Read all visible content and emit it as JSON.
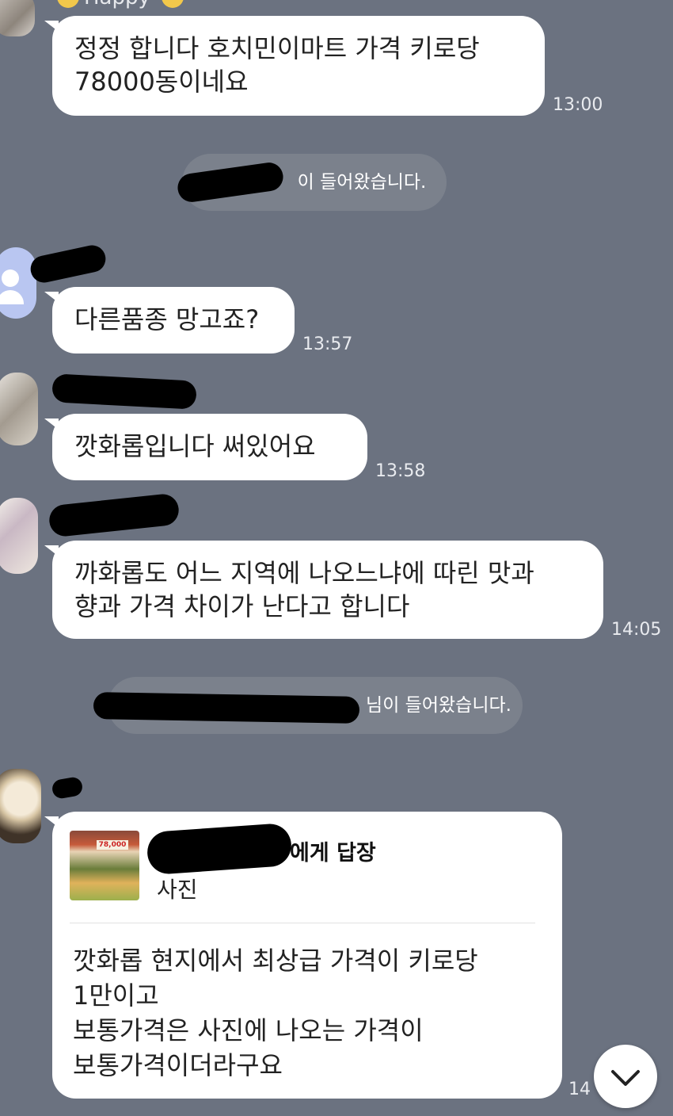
{
  "header_fragment": {
    "text": "Happy"
  },
  "messages": [
    {
      "text_line1": "정정 합니다 호치민이마트 가격 키로당",
      "text_line2": "78000동이네요",
      "time": "13:00"
    },
    {
      "text": "다른품종 망고죠?",
      "time": "13:57"
    },
    {
      "text": "깟화롭입니다 써있어요",
      "time": "13:58"
    },
    {
      "text_line1": "까화롭도 어느 지역에 나오느냐에 따린 맛과",
      "text_line2": "향과 가격 차이가 난다고 합니다",
      "time": "14:05"
    }
  ],
  "system": [
    {
      "text": "이 들어왔습니다."
    },
    {
      "text": "님이 들어왔습니다."
    }
  ],
  "reply": {
    "reply_to_label": "에게 답장",
    "reply_sub": "사진",
    "thumb_price": "78,000",
    "body": "깟화롭 현지에서 최상급 가격이 키로당\n1만이고\n보통가격은 사진에 나오는 가격이\n보통가격이더라구요",
    "time_partial": "14"
  },
  "icons": {
    "scroll_down": "chevron-down-icon",
    "default_avatar": "person-icon"
  }
}
